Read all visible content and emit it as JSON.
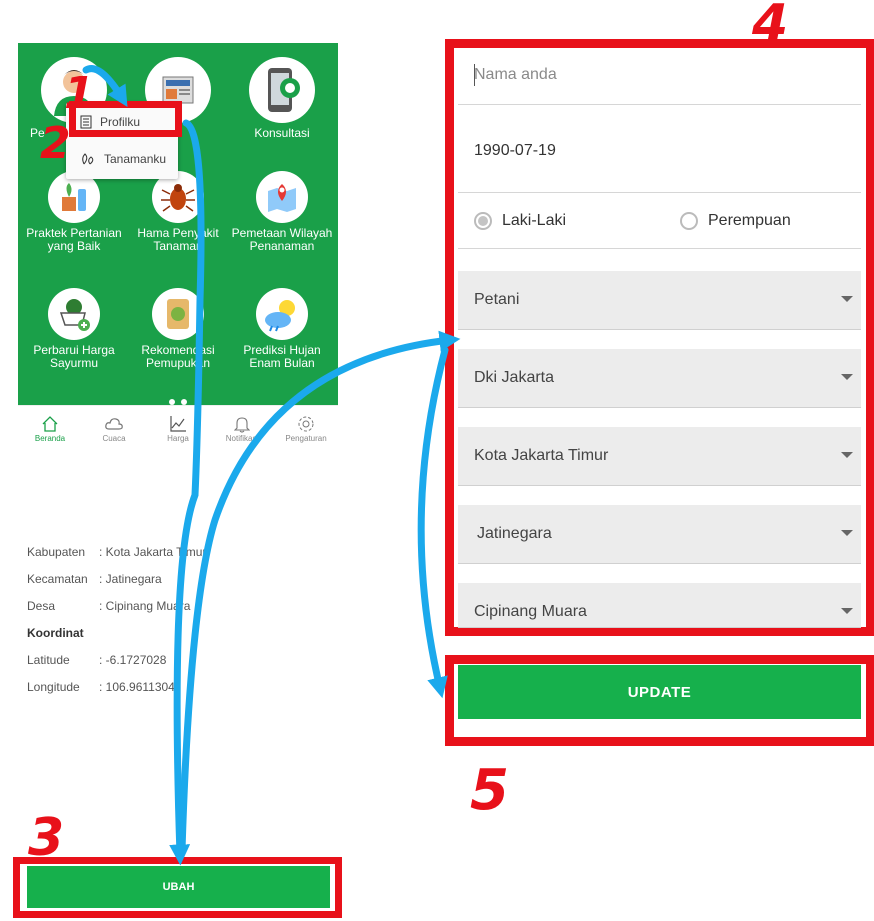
{
  "home": {
    "menu_items": [
      {
        "label": "Pe",
        "icon": "farmer-icon"
      },
      {
        "label": "",
        "icon": "news-icon"
      },
      {
        "label": "Konsultasi",
        "icon": "phone-chat-icon"
      },
      {
        "label": "Praktek Pertanian yang Baik",
        "icon": "spray-plant-icon"
      },
      {
        "label": "Hama Penyakit Tanaman",
        "icon": "insect-icon"
      },
      {
        "label": "Pemetaan Wilayah Penanaman",
        "icon": "map-pin-icon"
      },
      {
        "label": "Perbarui Harga Sayurmu",
        "icon": "vegetable-cart-icon"
      },
      {
        "label": "Rekomendasi Pemupukan",
        "icon": "fertilizer-bag-icon"
      },
      {
        "label": "Prediksi Hujan Enam Bulan",
        "icon": "weather-icon"
      }
    ],
    "context_menu": [
      {
        "label": "Profilku",
        "icon": "document-icon"
      },
      {
        "label": "Tanamanku",
        "icon": "plant-icon"
      }
    ],
    "nav": [
      {
        "label": "Beranda",
        "icon": "home-icon",
        "active": true
      },
      {
        "label": "Cuaca",
        "icon": "cloud-icon",
        "active": false
      },
      {
        "label": "Harga",
        "icon": "chart-icon",
        "active": false
      },
      {
        "label": "Notifikasi",
        "icon": "bell-icon",
        "active": false
      },
      {
        "label": "Pengaturan",
        "icon": "gear-icon",
        "active": false
      }
    ]
  },
  "location_info": {
    "kabupaten_label": "Kabupaten",
    "kabupaten_value": ": Kota Jakarta Timur",
    "kecamatan_label": "Kecamatan",
    "kecamatan_value": ":  Jatinegara",
    "desa_label": "Desa",
    "desa_value": ": Cipinang Muara",
    "koordinat_label": "Koordinat",
    "latitude_label": "Latitude",
    "latitude_value": ": -6.1727028",
    "longitude_label": "Longitude",
    "longitude_value": ": 106.9611304"
  },
  "ubah_button": "UBAH",
  "form": {
    "name_placeholder": "Nama anda",
    "birthdate": "1990-07-19",
    "gender_options": [
      "Laki-Laki",
      "Perempuan"
    ],
    "gender_selected": "Laki-Laki",
    "occupation": "Petani",
    "province": "Dki Jakarta",
    "city": "Kota Jakarta Timur",
    "district": "Jatinegara",
    "village": "Cipinang Muara"
  },
  "update_button": "UPDATE",
  "steps": [
    "1",
    "2",
    "3",
    "4",
    "5"
  ],
  "colors": {
    "green": "#1aa049",
    "button_green": "#16b04c",
    "highlight_red": "#e8111a",
    "arrow_blue": "#1ba9ec"
  }
}
